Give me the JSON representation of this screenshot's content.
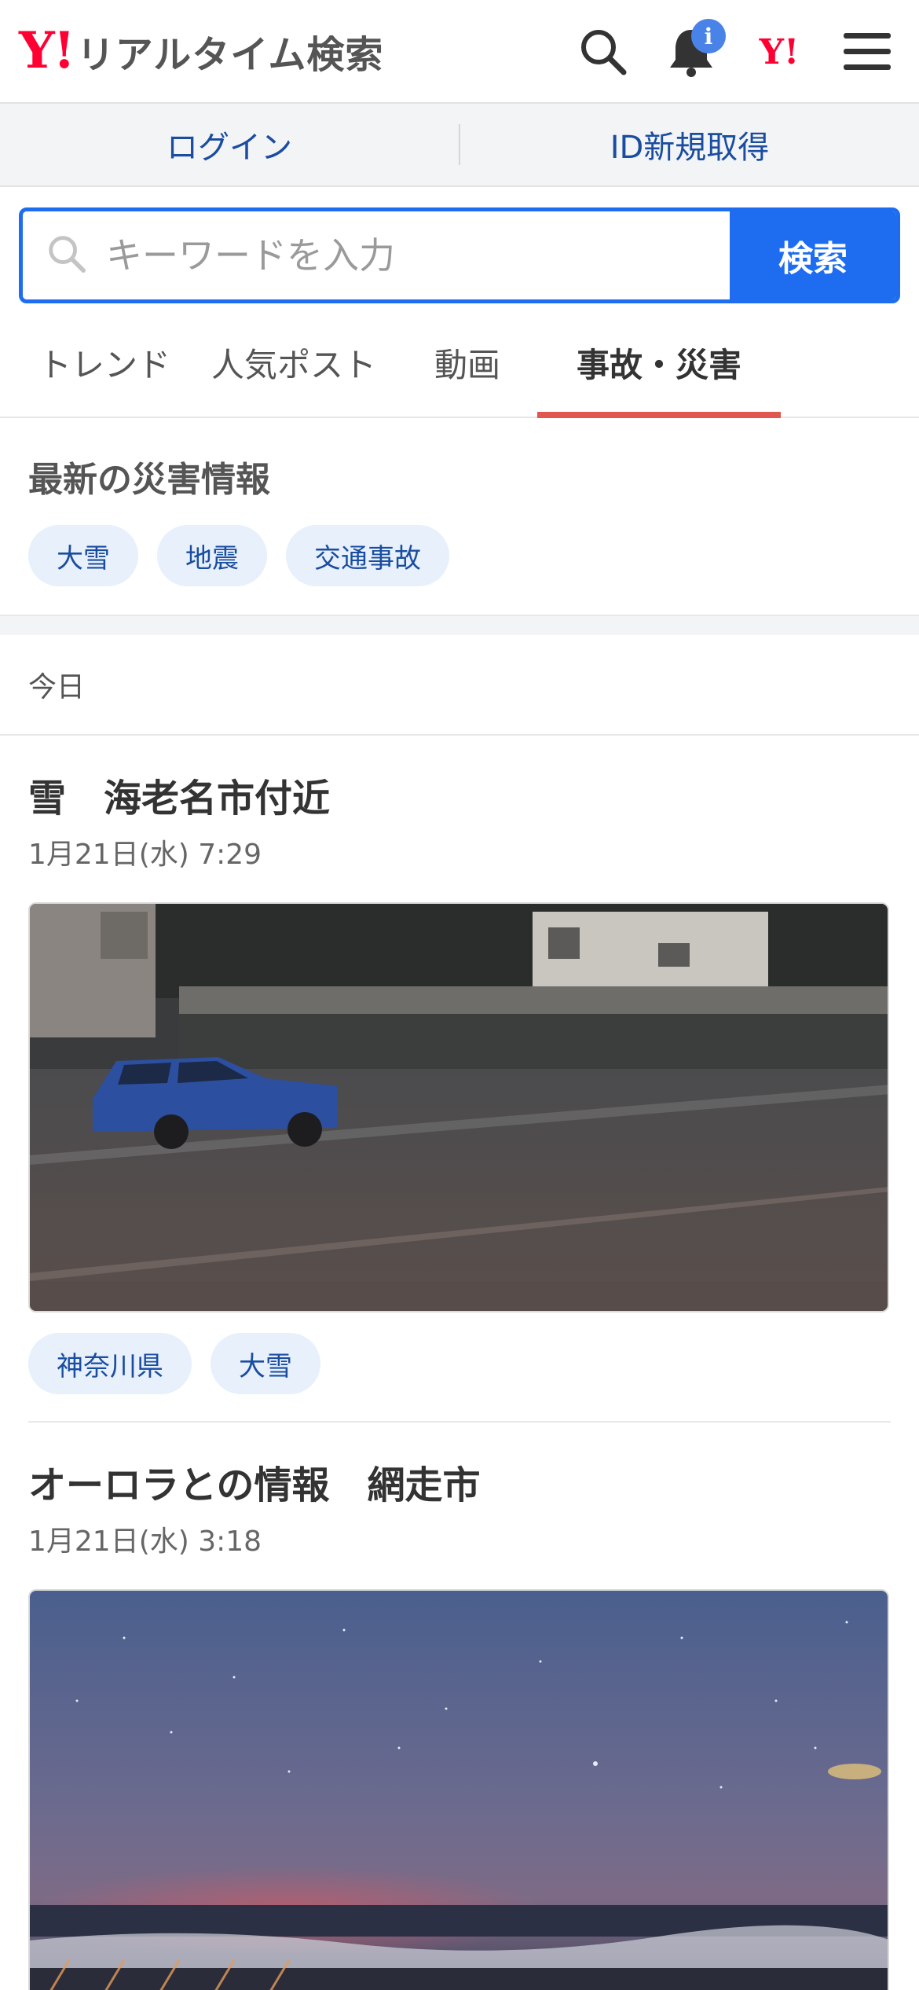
{
  "header": {
    "logo_mark": "Y!",
    "title": "リアルタイム検索",
    "notification_badge": "i",
    "yahoo_mini": "Y!"
  },
  "auth": {
    "login": "ログイン",
    "signup": "ID新規取得"
  },
  "search": {
    "placeholder": "キーワードを入力",
    "button": "検索"
  },
  "tabs": [
    {
      "label": "トレンド",
      "active": false
    },
    {
      "label": "人気ポスト",
      "active": false
    },
    {
      "label": "動画",
      "active": false
    },
    {
      "label": "事故・災害",
      "active": true
    }
  ],
  "disaster": {
    "title": "最新の災害情報",
    "chips": [
      "大雪",
      "地震",
      "交通事故"
    ]
  },
  "day_label": "今日",
  "posts": [
    {
      "title": "雪　海老名市付近",
      "time": "1月21日(水) 7:29",
      "tags": [
        "神奈川県",
        "大雪"
      ]
    },
    {
      "title": "オーロラとの情報　網走市",
      "time": "1月21日(水) 3:18",
      "tags": []
    }
  ],
  "colors": {
    "accent": "#1e6df0",
    "brand": "#ff0033",
    "tab_indicator": "#e0574f",
    "chip_bg": "#e7f0fb",
    "link": "#1a4da0"
  },
  "icons": [
    "search-icon",
    "bell-icon",
    "yahoo-logo-icon",
    "hamburger-menu-icon"
  ]
}
